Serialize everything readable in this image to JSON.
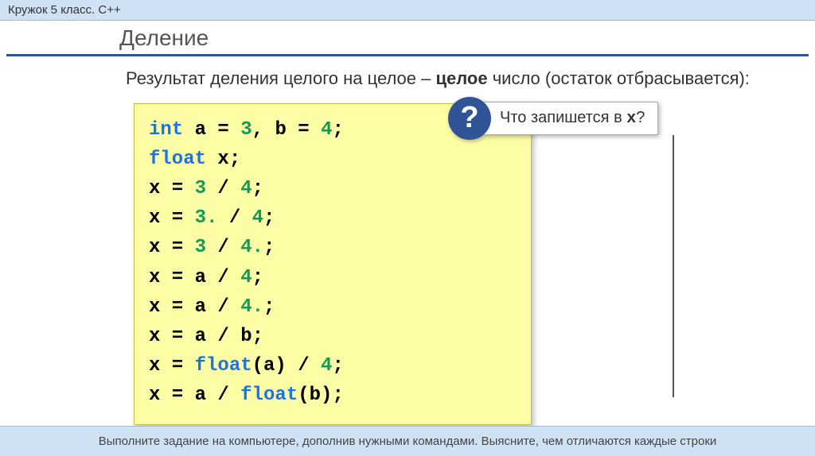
{
  "header": "Кружок 5 класс. C++",
  "title": "Деление",
  "description": {
    "prefix": "Результат деления целого на целое – ",
    "bold": "целое",
    "suffix": " число (остаток отбрасывается):"
  },
  "code": {
    "l1_kw": "int",
    "l1_rest": " a = ",
    "l1_n1": "3",
    "l1_mid": ", b = ",
    "l1_n2": "4",
    "l1_end": ";",
    "l2_kw": "float",
    "l2_rest": " x;",
    "l3a": "x = ",
    "l3n1": "3",
    "l3b": " / ",
    "l3n2": "4",
    "l3c": ";",
    "l4a": "x = ",
    "l4n1": "3.",
    "l4b": " / ",
    "l4n2": "4",
    "l4c": ";",
    "l5a": "x = ",
    "l5n1": "3",
    "l5b": " / ",
    "l5n2": "4.",
    "l5c": ";",
    "l6a": "x = a / ",
    "l6n": "4",
    "l6b": ";",
    "l7a": "x = a / ",
    "l7n": "4.",
    "l7b": ";",
    "l8": "x = a / b;",
    "l9a": "x = ",
    "l9kw": "float",
    "l9b": "(a) / ",
    "l9n": "4",
    "l9c": ";",
    "l10a": "x = a / ",
    "l10kw": "float",
    "l10b": "(b);"
  },
  "callout": {
    "mark": "?",
    "text_before": "Что запишется в ",
    "var": "x",
    "text_after": "?"
  },
  "footer": "Выполните задание на компьютере, дополнив нужными командами. Выясните, чем отличаются каждые строки"
}
